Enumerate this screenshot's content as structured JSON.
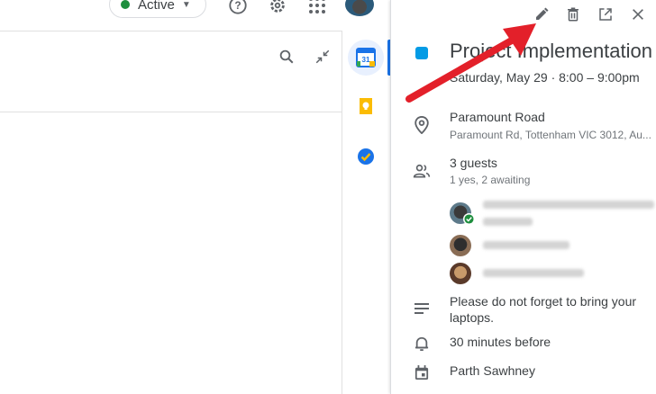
{
  "topbar": {
    "status_label": "Active",
    "status_color": "#1e8e3e",
    "icons": [
      "help-icon",
      "settings-gear-icon",
      "apps-grid-icon"
    ]
  },
  "toolbar": {
    "icons": [
      "search-icon",
      "collapse-icon"
    ]
  },
  "side_strip": {
    "items": [
      {
        "name": "calendar",
        "label": "31"
      },
      {
        "name": "keep",
        "icon": "lightbulb-icon"
      },
      {
        "name": "tasks",
        "icon": "tasks-check-icon"
      }
    ]
  },
  "event": {
    "tools": [
      "edit-pencil-icon",
      "delete-trash-icon",
      "open-in-new-icon",
      "close-icon"
    ],
    "color": "#039be5",
    "title": "Project Implementation",
    "when": "Saturday, May 29  ·  8:00 – 9:00pm",
    "location_name": "Paramount Road",
    "location_address": "Paramount Rd, Tottenham VIC 3012, Au...",
    "guests_summary": "3 guests",
    "guests_detail": "1 yes, 2 awaiting",
    "description": "Please do not forget to bring your laptops.",
    "reminder": "30 minutes before",
    "organizer": "Parth Sawhney"
  },
  "annotation_color": "#e3202a"
}
